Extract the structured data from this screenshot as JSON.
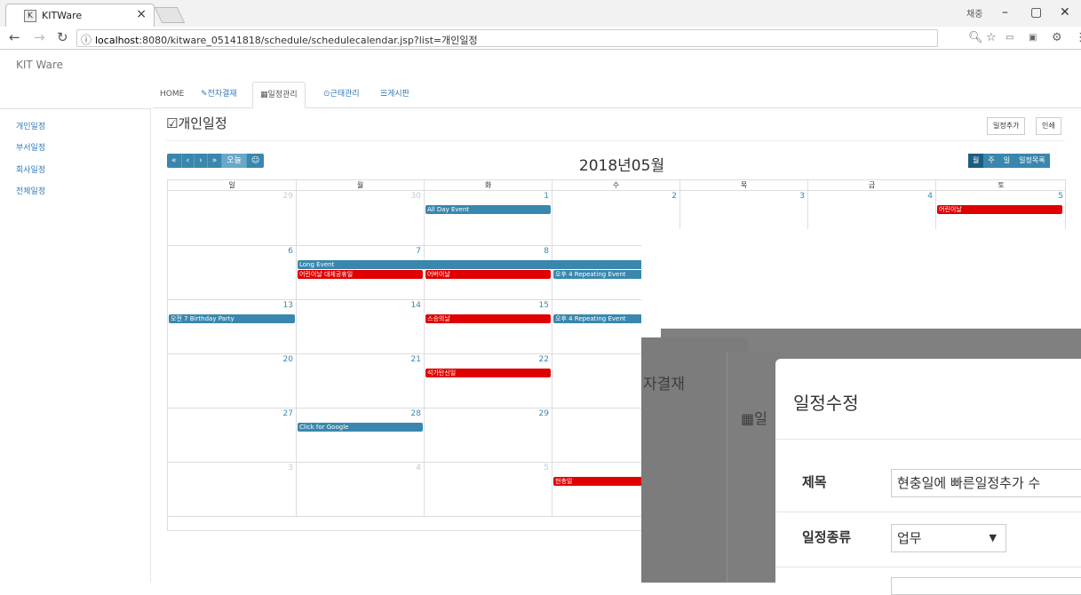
{
  "browser": {
    "tab_title": "KITWare",
    "tab_close": "×",
    "url_host": "localhost",
    "url_rest": ":8080/kitware_05141818/schedule/schedulecalendar.jsp?list=개인일정",
    "user": "채중"
  },
  "app": {
    "brand": "KIT Ware",
    "nav_tabs": [
      {
        "label": "HOME"
      },
      {
        "label": "전자결재",
        "icon": "edit-icon"
      },
      {
        "label": "일정관리",
        "icon": "calendar-icon"
      },
      {
        "label": "근태관리",
        "icon": "clock-icon"
      },
      {
        "label": "게시판",
        "icon": "list-icon"
      }
    ],
    "sidebar": [
      "개인일정",
      "부서일정",
      "회사일정",
      "전체일정"
    ],
    "page_title": "개인일정",
    "add_button": "일정추가",
    "print_button": "인쇄"
  },
  "calendar": {
    "nav": [
      "«",
      "‹",
      "›",
      "»",
      "오늘",
      "☺"
    ],
    "month_title": "2018년05월",
    "views": [
      "월",
      "주",
      "일",
      "일정목록"
    ],
    "weekdays": [
      "일",
      "월",
      "화",
      "수",
      "목",
      "금",
      "토"
    ],
    "weeks": [
      [
        "29",
        "30",
        "1",
        "2",
        "3",
        "4",
        "5"
      ],
      [
        "6",
        "7",
        "8",
        "",
        "",
        "",
        ""
      ],
      [
        "13",
        "14",
        "15",
        "",
        "",
        "",
        ""
      ],
      [
        "20",
        "21",
        "22",
        "",
        "",
        "",
        ""
      ],
      [
        "27",
        "28",
        "29",
        "",
        "",
        "",
        ""
      ],
      [
        "3",
        "4",
        "5",
        "",
        "",
        "",
        ""
      ]
    ],
    "events": {
      "all_day": "All Day Event",
      "childrens_day": "어린이날",
      "long_event": "Long Event",
      "childrens_substitute": "어린이날 대체공휴일",
      "parents_day": "어버이날",
      "repeating_1": "오후 4 Repeating Event",
      "birthday": "오전 7 Birthday Party",
      "teachers_day": "스승의날",
      "repeating_2": "오후 4 Repeating Event",
      "buddha": "석가탄신일",
      "google": "Click for Google",
      "memorial": "현충일"
    }
  },
  "overlay": {
    "tab_text": "자결재",
    "cal_text": "일",
    "modal_title": "일정수정",
    "title_label": "제목",
    "title_value": "현충일에 빠른일정추가 수",
    "type_label": "일정종류",
    "type_value": "업무"
  }
}
